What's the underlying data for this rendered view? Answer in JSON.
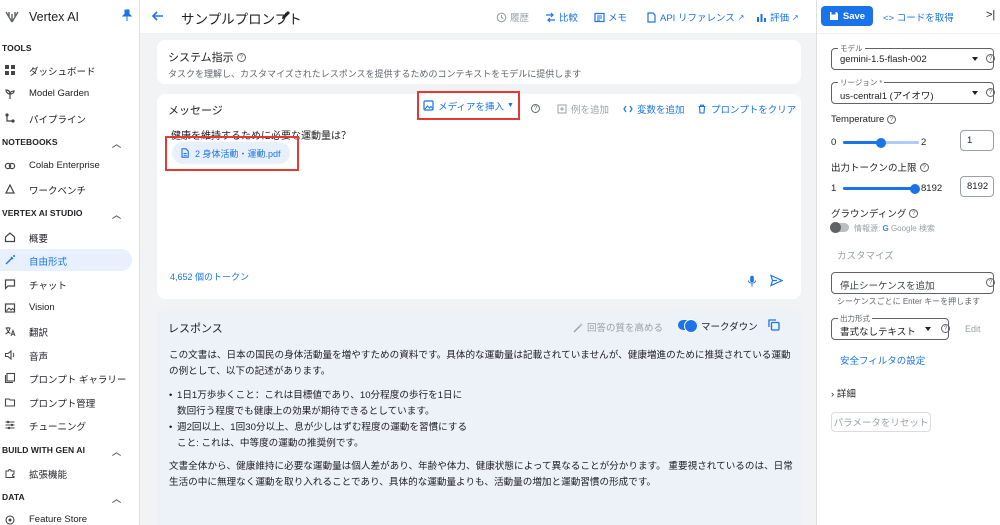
{
  "app": {
    "title": "Vertex AI"
  },
  "sidebar": {
    "sections": [
      {
        "title": "TOOLS",
        "items": [
          "ダッシュボード",
          "Model Garden",
          "パイプライン"
        ]
      },
      {
        "title": "NOTEBOOKS",
        "items": [
          "Colab Enterprise",
          "ワークベンチ"
        ]
      },
      {
        "title": "VERTEX AI STUDIO",
        "items": [
          "概要",
          "自由形式",
          "チャット",
          "Vision",
          "翻訳",
          "音声",
          "プロンプト ギャラリー",
          "プロンプト管理",
          "チューニング"
        ]
      },
      {
        "title": "BUILD WITH GEN AI",
        "items": [
          "拡張機能"
        ]
      },
      {
        "title": "DATA",
        "items": [
          "Feature Store"
        ]
      }
    ],
    "active": "自由形式"
  },
  "header": {
    "title": "サンプルプロンプト",
    "history": "履歴",
    "compare": "比較",
    "memo": "メモ",
    "api_ref": "API リファレンス",
    "rating": "評価"
  },
  "system": {
    "title": "システム指示",
    "description": "タスクを理解し、カスタマイズされたレスポンスを提供するためのコンテキストをモデルに提供します"
  },
  "message": {
    "title": "メッセージ",
    "insert_media": "メディアを挿入",
    "add_example": "例を追加",
    "add_variable": "変数を追加",
    "clear_prompt": "プロンプトをクリア",
    "prompt_text": "健康を維持するために必要な運動量は？",
    "file_name": "2 身体活動・運動.pdf",
    "tokens": "4,652 個のトークン"
  },
  "response": {
    "title": "レスポンス",
    "improve": "回答の質を高める",
    "markdown": "マークダウン",
    "p1_l1": "この文書は、日本の国民の身体活動量を増やすための資料です。具体的な運動量は記載されていませんが、健康増進のために推奨されている運動",
    "p1_l2": "の例として、以下の記述があります。",
    "b1_l1": "1日1万歩歩くこと：これは目標値であり、10分程度の歩行を1日に",
    "b1_l2": "数回行う程度でも健康上の効果が期待できるとしています。",
    "b2_l1": "週2回以上、1回30分以上、息が少しはずむ程度の運動を習慣にする",
    "b2_l2": "こと: これは、中等度の運動の推奨例です。",
    "p2_l1": "文書全体から、健康維持に必要な運動量は個人差があり、年齢や体力、健康状態によって異なることが分かります。 重要視されているのは、日常",
    "p2_l2": "生活の中に無理なく運動を取り入れることであり、具体的な運動量よりも、活動量の増加と運動習慣の形成です。"
  },
  "panel": {
    "save": "Save",
    "get_code": "コードを取得",
    "model_label": "モデル",
    "model_value": "gemini-1.5-flash-002",
    "region_label": "リージョン *",
    "region_value": "us-central1 (アイオワ)",
    "temperature_label": "Temperature",
    "temp_min": "0",
    "temp_max": "2",
    "temp_value": "1",
    "temp_fraction": 0.5,
    "token_label": "出力トークンの上限",
    "token_min": "1",
    "token_max": "8192",
    "token_value": "8192",
    "token_fraction": 1.0,
    "grounding_label": "グラウンディング",
    "grounding_source": "情報源:",
    "grounding_google": "G",
    "grounding_search": "Google 検索",
    "customize": "カスタマイズ",
    "stop_placeholder": "停止シーケンスを追加",
    "stop_hint": "シーケンスごとに Enter キーを押します",
    "format_label": "出力形式",
    "format_value": "書式なしテキスト",
    "edit": "Edit",
    "safety": "安全フィルタの設定",
    "details": "詳細",
    "reset": "パラメータをリセット"
  },
  "colors": {
    "accent": "#1a73e8",
    "highlight": "#e53935",
    "response_bg": "#edf1f8"
  }
}
